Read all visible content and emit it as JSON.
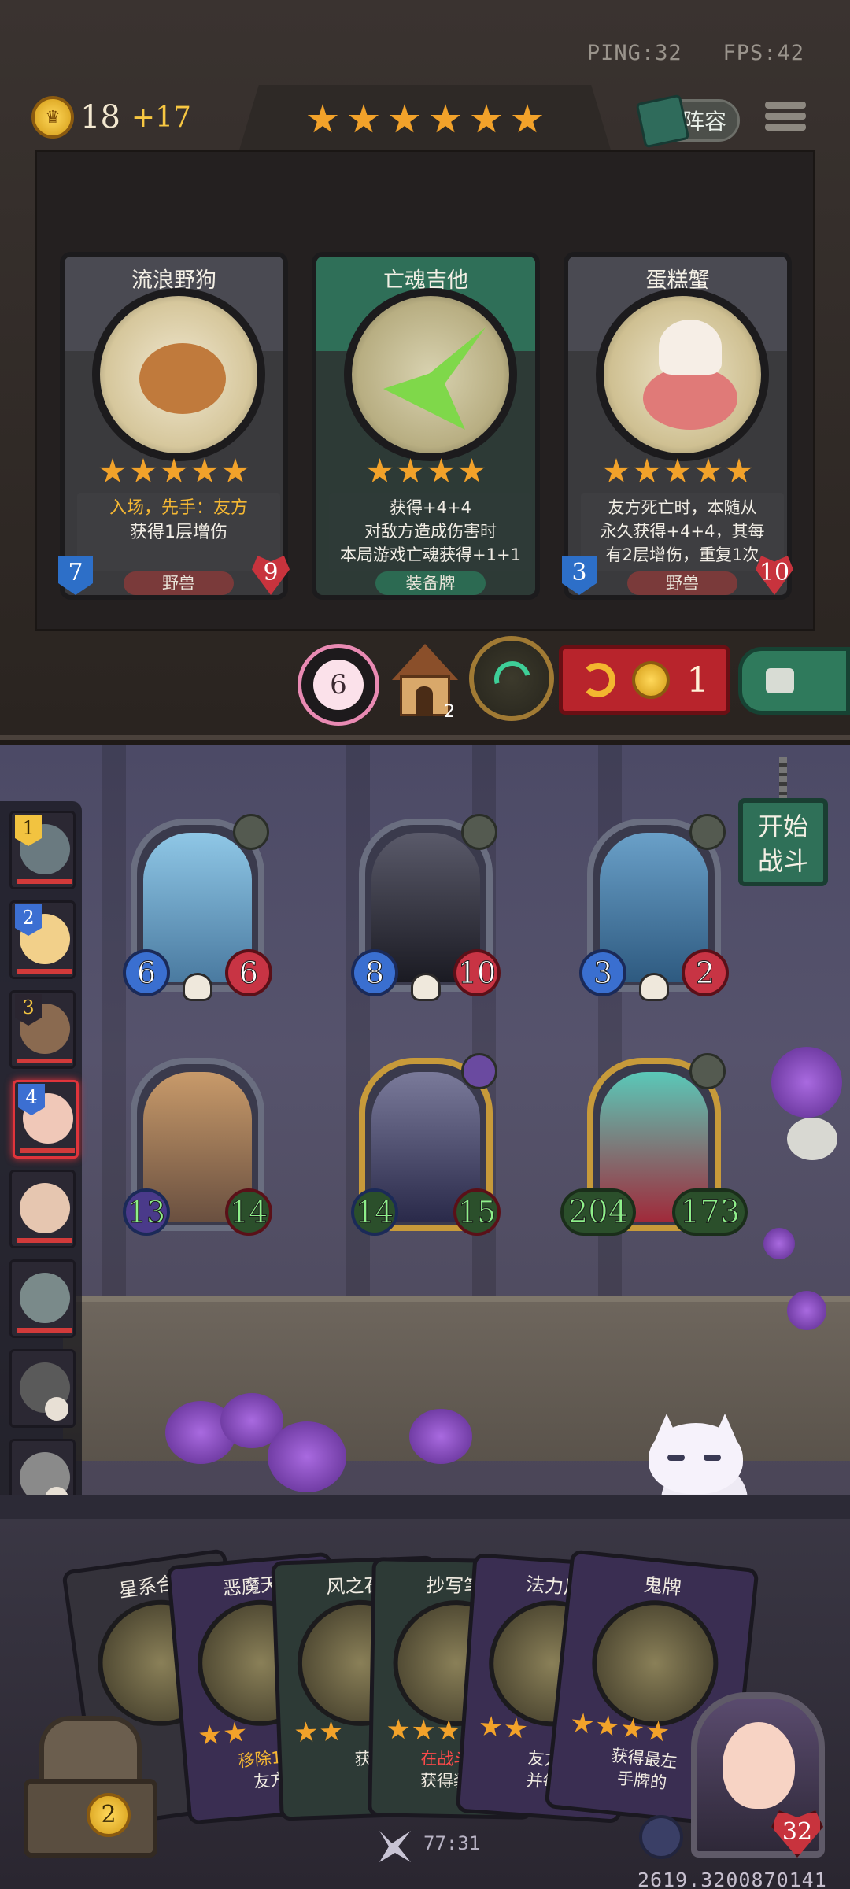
{
  "hud": {
    "ping": "PING:32",
    "fps": "FPS:42"
  },
  "gold": {
    "value": "18",
    "increment": "+17"
  },
  "lineup_label": "阵容",
  "tavern_stars": 6,
  "shop": [
    {
      "name": "流浪野狗",
      "stars": 5,
      "desc_lines": [
        "入场，先手：友方",
        "获得1层增伤"
      ],
      "tag": "野兽",
      "attack": "7",
      "health": "9",
      "theme": "#3b3b3f"
    },
    {
      "name": "亡魂吉他",
      "stars": 4,
      "desc_lines": [
        "获得+4+4",
        "对敌方造成伤害时",
        "本局游戏亡魂获得+1+1"
      ],
      "tag": "装备牌",
      "attack": "",
      "health": "",
      "theme": "#2f6f58"
    },
    {
      "name": "蛋糕蟹",
      "stars": 5,
      "desc_lines": [
        "友方死亡时，本随从",
        "永久获得+4+4，其每",
        "有2层增伤，重复1次"
      ],
      "tag": "野兽",
      "attack": "3",
      "health": "10",
      "theme": "#3b3b3f"
    }
  ],
  "actions": {
    "capture_count": "6",
    "house_count": "2",
    "refresh_cost": "1"
  },
  "start_button": [
    "开始",
    "战斗"
  ],
  "side_ranks": [
    "1",
    "2",
    "3",
    "4"
  ],
  "board": [
    {
      "attack": "6",
      "health": "6"
    },
    {
      "attack": "8",
      "health": "10"
    },
    {
      "attack": "3",
      "health": "2"
    },
    {
      "attack": "13",
      "health": "14"
    },
    {
      "attack": "14",
      "health": "15"
    },
    {
      "attack": "204",
      "health": "173"
    }
  ],
  "hand": [
    {
      "name": "星系合",
      "stars": 0,
      "desc": ""
    },
    {
      "name": "恶魔天",
      "stars": 2,
      "desc": "移除1个",
      "desc2": "友方"
    },
    {
      "name": "风之石",
      "stars": 2,
      "desc": "获",
      "desc2": ""
    },
    {
      "name": "抄写笔",
      "stars": 3,
      "desc": "在战斗后",
      "desc2": "获得装备"
    },
    {
      "name": "法力风",
      "stars": 2,
      "desc": "友方",
      "desc2": "并每"
    },
    {
      "name": "鬼牌",
      "stars": 4,
      "desc": "获得最左",
      "desc2": "手牌的"
    }
  ],
  "chest_count": "2",
  "timer": "77:31",
  "coords": "2619.3200870141",
  "hero_health": "32",
  "colors": {
    "gold": "#f7c742",
    "star": "#f2a22a",
    "refresh": "#b8242c",
    "start": "#2f7058"
  }
}
